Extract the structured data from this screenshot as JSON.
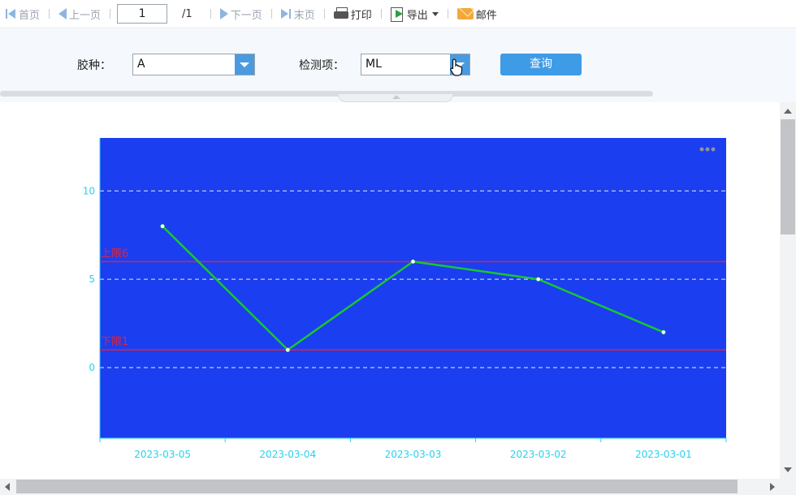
{
  "toolbar": {
    "first_label": "首页",
    "prev_label": "上一页",
    "page_value": "1",
    "page_total": "/1",
    "next_label": "下一页",
    "last_label": "末页",
    "print_label": "打印",
    "export_label": "导出",
    "mail_label": "邮件",
    "icons": [
      "first-page-icon",
      "prev-page-icon",
      "next-page-icon",
      "last-page-icon",
      "print-icon",
      "export-icon",
      "caret-down-icon",
      "mail-icon"
    ]
  },
  "filter": {
    "rubber_label": "胶种：",
    "rubber_value": "A",
    "item_label": "检测项：",
    "item_value": "ML",
    "query_label": "查询",
    "accent_color": "#3e9be6"
  },
  "chart_data": {
    "type": "line",
    "title": "",
    "xlabel": "",
    "ylabel": "",
    "categories": [
      "2023-03-05",
      "2023-03-04",
      "2023-03-03",
      "2023-03-02",
      "2023-03-01"
    ],
    "series": [
      {
        "values": [
          8,
          1,
          6,
          5,
          2
        ],
        "color": "#19c72f"
      }
    ],
    "mark_lines": [
      {
        "label": "上限6",
        "value": 6,
        "color": "#e0243a"
      },
      {
        "label": "下限1",
        "value": 1,
        "color": "#e0243a"
      }
    ],
    "yticks": [
      0,
      5,
      10
    ],
    "ylim": [
      -4,
      13
    ],
    "grid": "dashed horizontal",
    "background_color": "#1b3ef0",
    "axis_color": "#28d2ee",
    "more_menu_icon": "more-dots-icon"
  }
}
